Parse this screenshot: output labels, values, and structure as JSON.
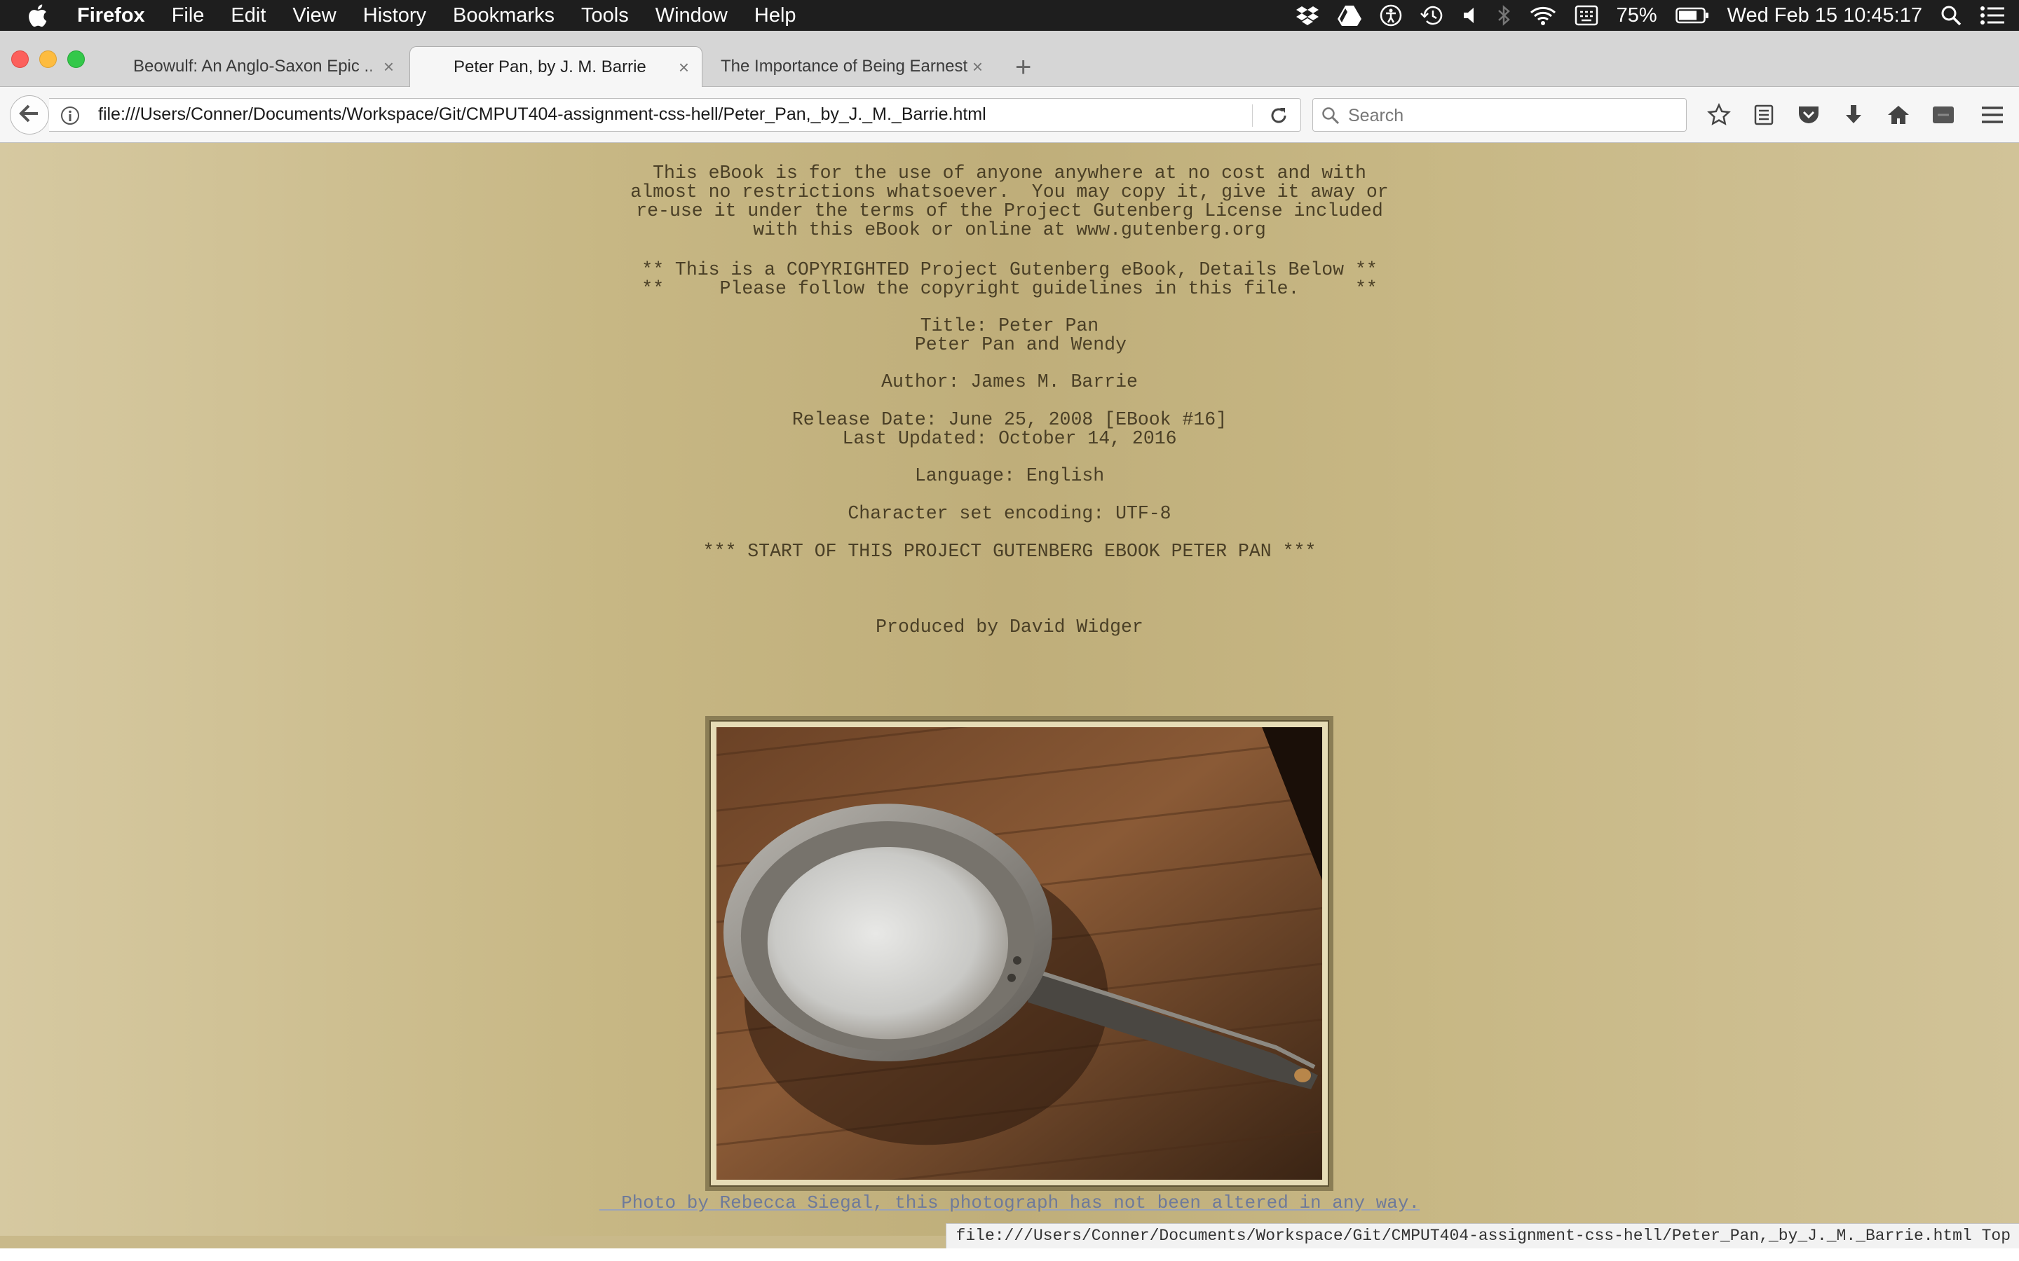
{
  "menubar": {
    "app_name": "Firefox",
    "items": [
      "File",
      "Edit",
      "View",
      "History",
      "Bookmarks",
      "Tools",
      "Window",
      "Help"
    ],
    "battery": "75%",
    "datetime": "Wed Feb 15  10:45:17"
  },
  "tabs": [
    {
      "title": "Beowulf: An Anglo-Saxon Epic ...",
      "active": false
    },
    {
      "title": "Peter Pan, by J. M. Barrie",
      "active": true
    },
    {
      "title": "The Importance of Being Earnest",
      "active": false
    }
  ],
  "tab_close_glyph": "×",
  "new_tab_glyph": "+",
  "navbar": {
    "url": "file:///Users/Conner/Documents/Workspace/Git/CMPUT404-assignment-css-hell/Peter_Pan,_by_J._M._Barrie.html",
    "search_placeholder": "Search"
  },
  "page": {
    "license_lines": "This eBook is for the use of anyone anywhere at no cost and with\nalmost no restrictions whatsoever.  You may copy it, give it away or\nre-use it under the terms of the Project Gutenberg License included\nwith this eBook or online at www.gutenberg.org",
    "copyright_lines": "** This is a COPYRIGHTED Project Gutenberg eBook, Details Below **\n**     Please follow the copyright guidelines in this file.     **",
    "title_lines": "Title: Peter Pan\n  Peter Pan and Wendy",
    "author": "Author: James M. Barrie",
    "release_lines": "Release Date: June 25, 2008 [EBook #16]\nLast Updated: October 14, 2016",
    "language": "Language: English",
    "encoding": "Character set encoding: UTF-8",
    "start_marker": "*** START OF THIS PROJECT GUTENBERG EBOOK PETER PAN ***",
    "producer": "Produced by David Widger",
    "photo_caption": "  Photo by Rebecca Siegal, this photograph has not been altered in any way."
  },
  "statusbar": {
    "text": "file:///Users/Conner/Documents/Workspace/Git/CMPUT404-assignment-css-hell/Peter_Pan,_by_J._M._Barrie.html Top"
  },
  "colors": {
    "page_bg": "#c7b784",
    "text": "#4a3f26",
    "caption_link": "#6e7a9a"
  },
  "icons": [
    "apple-icon",
    "dropbox-icon",
    "google-drive-icon",
    "accessibility-icon",
    "time-machine-icon",
    "volume-icon",
    "bluetooth-icon",
    "wifi-icon",
    "keyboard-icon",
    "battery-icon",
    "spotlight-icon",
    "notification-center-icon",
    "back-icon",
    "info-icon",
    "reload-icon",
    "search-icon",
    "bookmark-star-icon",
    "reader-list-icon",
    "pocket-icon",
    "download-icon",
    "home-icon",
    "extension-icon",
    "hamburger-menu-icon"
  ]
}
